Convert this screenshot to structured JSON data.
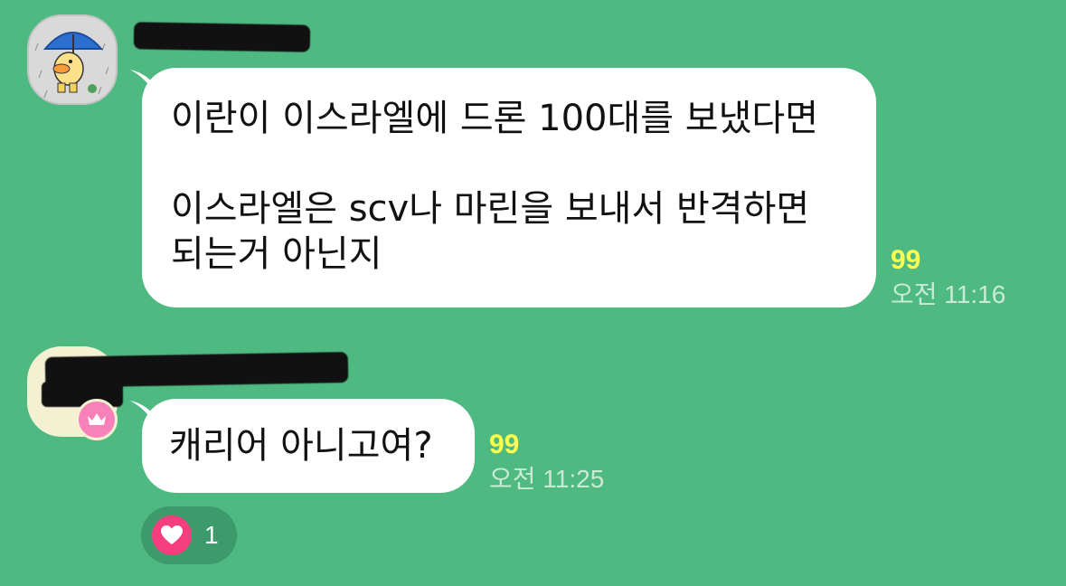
{
  "messages": [
    {
      "lines": [
        "이란이 이스라엘에 드론 100대를 보냈다면",
        "",
        "이스라엘은 scv나 마린을 보내서 반격하면",
        "되는거 아닌지"
      ],
      "unread_count": "99",
      "time": "오전 11:16"
    },
    {
      "lines": [
        "캐리어 아니고여?"
      ],
      "unread_count": "99",
      "time": "오전 11:25",
      "reaction": {
        "icon": "heart-icon",
        "count": "1"
      }
    }
  ],
  "colors": {
    "background": "#4fb982",
    "bubble": "#ffffff",
    "unread": "#ffff4d",
    "time": "#c9ead4",
    "reaction_heart": "#f63d7e",
    "owner_badge": "#f781b8"
  },
  "icons": {
    "avatar_1": "duck-umbrella-avatar",
    "avatar_2": "redacted-avatar",
    "badge": "crown-icon"
  }
}
